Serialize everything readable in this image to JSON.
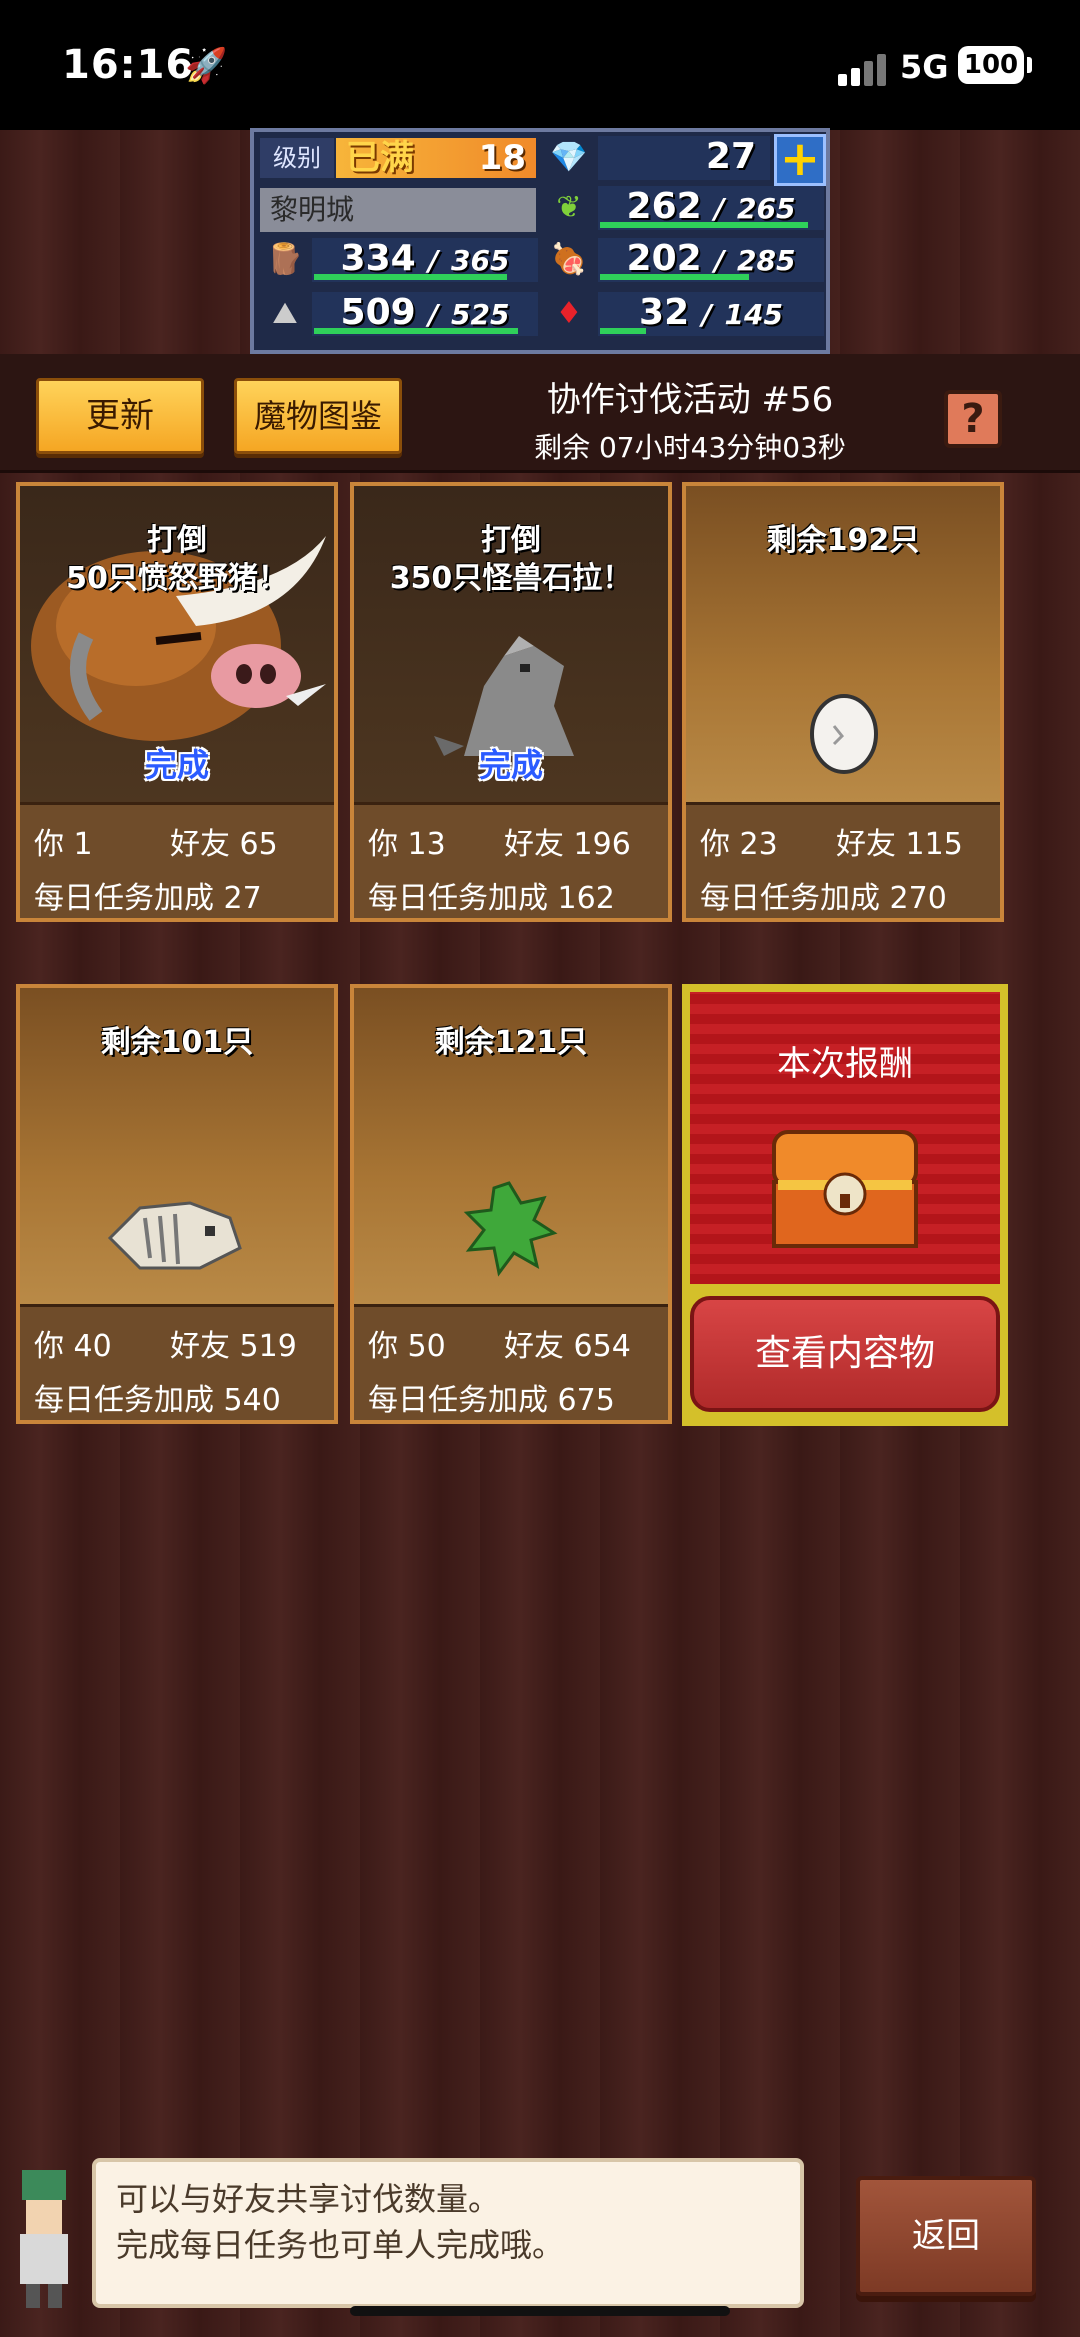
{
  "status": {
    "time": "16:16",
    "network": "5G",
    "battery": "100"
  },
  "resources": {
    "level_label": "级别",
    "level_max": "已满",
    "level": "18",
    "gems": "27",
    "town": "黎明城",
    "grass": {
      "value": "262",
      "max": "265",
      "fill": 0.99
    },
    "wood": {
      "value": "334",
      "max": "365",
      "fill": 0.92
    },
    "food": {
      "value": "202",
      "max": "285",
      "fill": 0.71
    },
    "ore": {
      "value": "509",
      "max": "525",
      "fill": 0.97
    },
    "ruby": {
      "value": "32",
      "max": "145",
      "fill": 0.22
    },
    "separator": "/"
  },
  "header": {
    "refresh": "更新",
    "monster_book": "魔物图鉴",
    "event_title": "协作讨伐活动 #56",
    "remaining": "剩余 07小时43分钟03秒",
    "help": "?"
  },
  "cards": [
    {
      "caption1": "打倒",
      "caption2": "50只愤怒野猪！",
      "done": "完成",
      "you_label": "你",
      "you": "1",
      "friend_label": "好友",
      "friend": "65",
      "bonus_label": "每日任务加成",
      "bonus": "27",
      "creature": "boar-icon"
    },
    {
      "caption1": "打倒",
      "caption2": "350只怪兽石拉！",
      "done": "完成",
      "you_label": "你",
      "you": "13",
      "friend_label": "好友",
      "friend": "196",
      "bonus_label": "每日任务加成",
      "bonus": "162",
      "creature": "stone-monster-icon"
    },
    {
      "caption1": "剩余192只",
      "you_label": "你",
      "you": "23",
      "friend_label": "好友",
      "friend": "115",
      "bonus_label": "每日任务加成",
      "bonus": "270",
      "creature": "egg-icon"
    },
    {
      "caption1": "剩余101只",
      "you_label": "你",
      "you": "40",
      "friend_label": "好友",
      "friend": "519",
      "bonus_label": "每日任务加成",
      "bonus": "540",
      "creature": "skeleton-icon"
    },
    {
      "caption1": "剩余121只",
      "you_label": "你",
      "you": "50",
      "friend_label": "好友",
      "friend": "654",
      "bonus_label": "每日任务加成",
      "bonus": "675",
      "creature": "grass-monster-icon"
    }
  ],
  "reward": {
    "title": "本次报酬",
    "button": "查看内容物"
  },
  "dialog": {
    "line1": "可以与好友共享讨伐数量。",
    "line2": "完成每日任务也可单人完成哦。"
  },
  "back": "返回"
}
